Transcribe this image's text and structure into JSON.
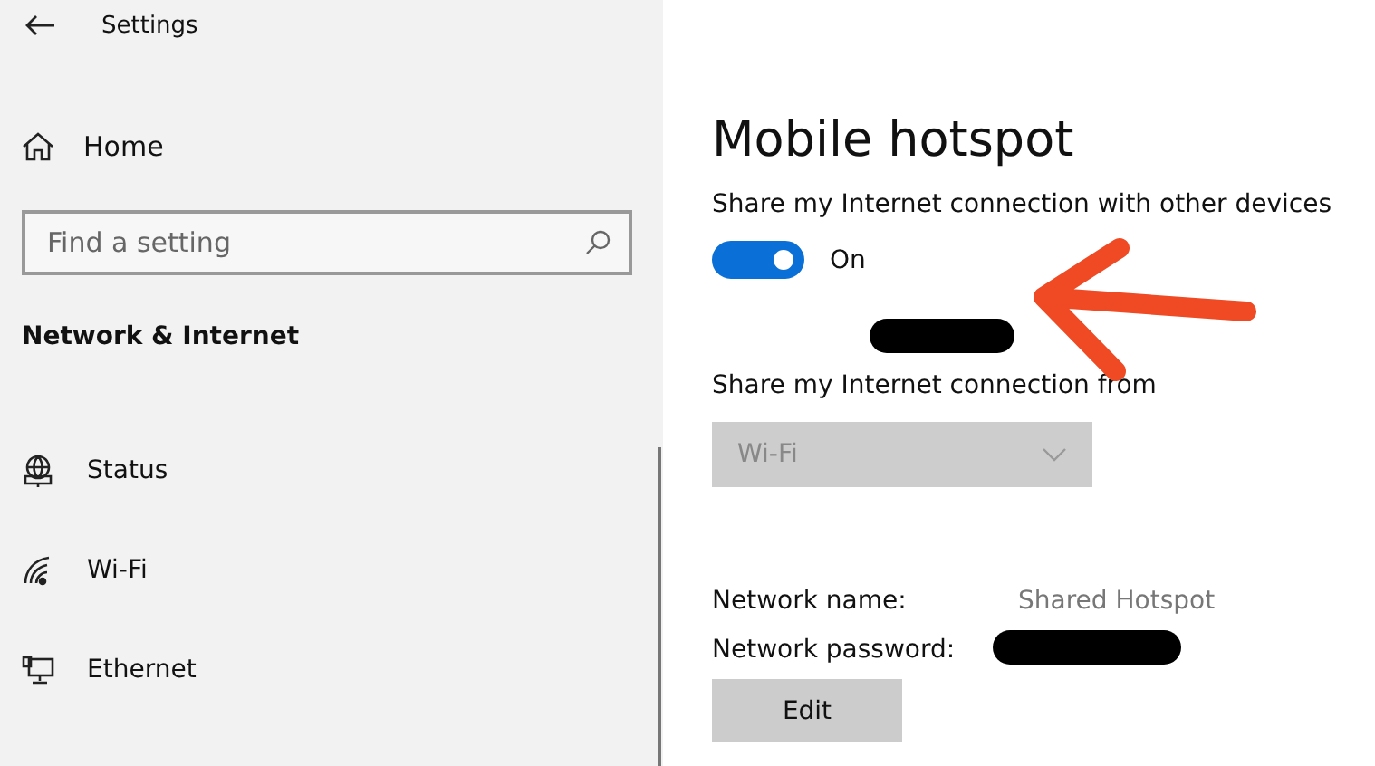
{
  "window": {
    "title": "Settings"
  },
  "sidebar": {
    "home": "Home",
    "search": {
      "placeholder": "Find a setting"
    },
    "section": "Network & Internet",
    "items": [
      {
        "label": "Status",
        "kind": "status"
      },
      {
        "label": "Wi-Fi",
        "kind": "wifi"
      },
      {
        "label": "Ethernet",
        "kind": "ethernet"
      }
    ]
  },
  "page": {
    "title": "Mobile hotspot",
    "share_toggle": {
      "label": "Share my Internet connection with other devices",
      "on": true,
      "state_text": "On"
    },
    "share_from": {
      "label": "Share my Internet connection from",
      "value": "Wi-Fi",
      "disabled": true
    },
    "details": [
      {
        "label": "Network name:",
        "value": "Shared Hotspot"
      },
      {
        "label": "Network password:"
      }
    ],
    "edit_button": "Edit"
  }
}
